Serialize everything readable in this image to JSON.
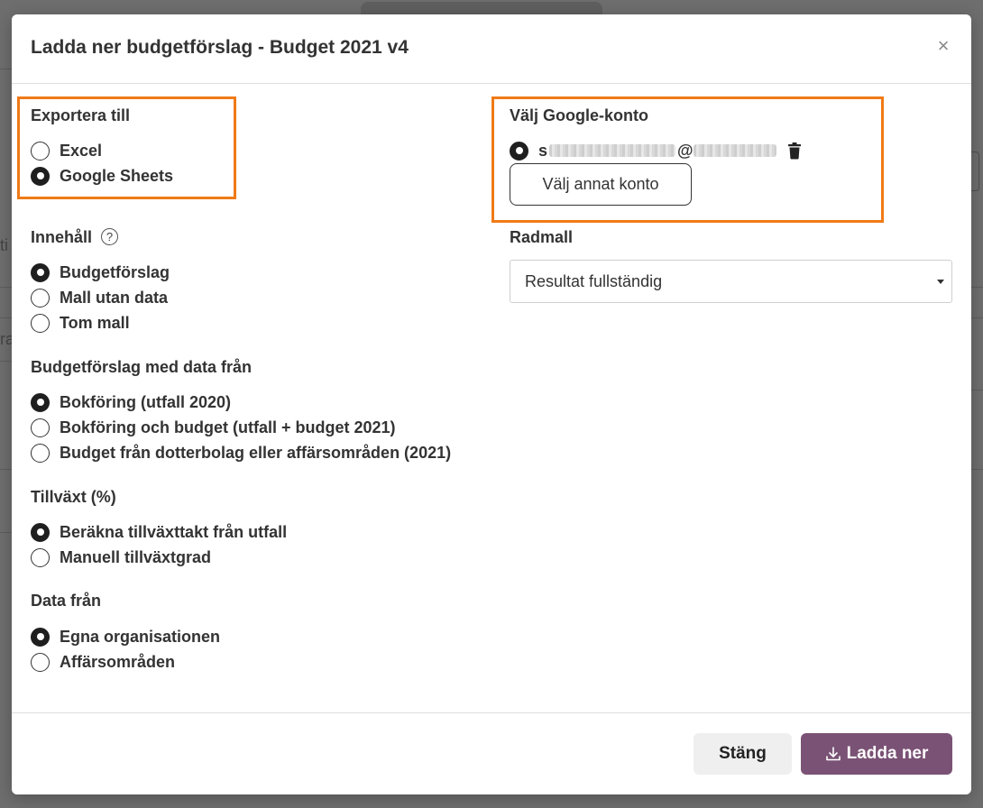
{
  "dialog": {
    "title": "Ladda ner budgetförslag - Budget 2021 v4",
    "close_label": "×"
  },
  "export": {
    "label": "Exportera till",
    "options": [
      {
        "label": "Excel",
        "checked": false
      },
      {
        "label": "Google Sheets",
        "checked": true
      }
    ]
  },
  "google_account": {
    "label": "Välj Google-konto",
    "email_prefix": "s",
    "email_at": "@",
    "other_account_button": "Välj annat konto"
  },
  "content": {
    "label": "Innehåll",
    "help_icon": "?",
    "options": [
      {
        "label": "Budgetförslag",
        "checked": true
      },
      {
        "label": "Mall utan data",
        "checked": false
      },
      {
        "label": "Tom mall",
        "checked": false
      }
    ]
  },
  "row_template": {
    "label": "Radmall",
    "selected": "Resultat fullständig"
  },
  "data_source": {
    "label": "Budgetförslag med data från",
    "options": [
      {
        "label": "Bokföring (utfall 2020)",
        "checked": true
      },
      {
        "label": "Bokföring och budget (utfall + budget 2021)",
        "checked": false
      },
      {
        "label": "Budget från dotterbolag eller affärsområden (2021)",
        "checked": false
      }
    ]
  },
  "growth": {
    "label": "Tillväxt (%)",
    "options": [
      {
        "label": "Beräkna tillväxttakt från utfall",
        "checked": true
      },
      {
        "label": "Manuell tillväxtgrad",
        "checked": false
      }
    ]
  },
  "data_from": {
    "label": "Data från",
    "options": [
      {
        "label": "Egna organisationen",
        "checked": true
      },
      {
        "label": "Affärsområden",
        "checked": false
      }
    ]
  },
  "footer": {
    "close_button": "Stäng",
    "download_button": "Ladda ner"
  },
  "background": {
    "left_fragment_1": "ti",
    "left_fragment_2": "ra"
  },
  "colors": {
    "highlight": "#f07a17",
    "primary": "#7a5275"
  }
}
